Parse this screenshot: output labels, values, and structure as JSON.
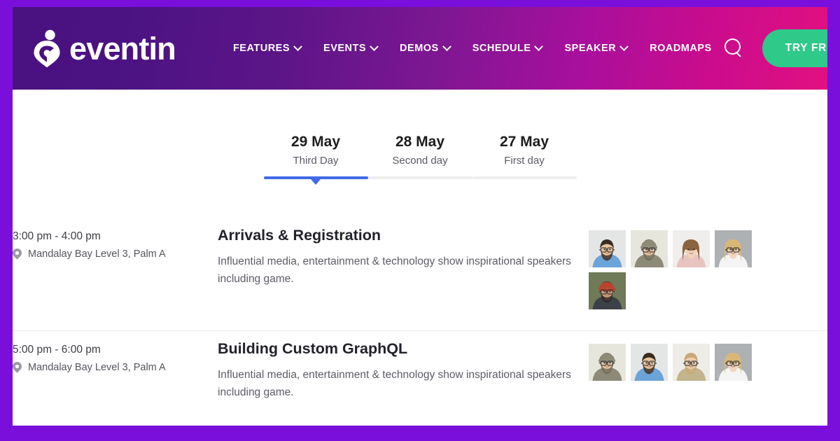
{
  "header": {
    "brand_name": "eventin",
    "brand_icon": "location-pin-check-logo",
    "nav": [
      {
        "label": "FEATURES",
        "has_dropdown": true
      },
      {
        "label": "EVENTS",
        "has_dropdown": true
      },
      {
        "label": "DEMOS",
        "has_dropdown": true
      },
      {
        "label": "SCHEDULE",
        "has_dropdown": true
      },
      {
        "label": "SPEAKER",
        "has_dropdown": true
      },
      {
        "label": "ROADMAPS",
        "has_dropdown": false
      }
    ],
    "search_icon": "search-icon",
    "cta_label": "TRY FREE",
    "cta_icon": "download-icon",
    "cta_color": "#2FC98A",
    "gradient_start": "#4A1280",
    "gradient_end": "#E21080"
  },
  "frame": {
    "border_color": "#7A0FDC",
    "background": "#ffffff"
  },
  "tabs": {
    "active_index": 0,
    "active_color": "#4169E8",
    "inactive_color": "#eeeeee",
    "items": [
      {
        "date": "29 May",
        "label": "Third Day"
      },
      {
        "date": "28 May",
        "label": "Second day"
      },
      {
        "date": "27 May",
        "label": "First day"
      }
    ]
  },
  "schedule": [
    {
      "time": "3:00 pm - 4:00 pm",
      "venue_icon": "map-pin-icon",
      "venue": "Mandalay Bay Level 3, Palm A",
      "title": "Arrivals & Registration",
      "description": "Influential media, entertainment & technology show inspirational speakers including game.",
      "speakers": [
        {
          "name": "speaker-avatar-1",
          "skin": "#e8c49c",
          "hair": "#3a2b21",
          "shirt": "#6ba4d8",
          "bg": "#e4e6e6",
          "glasses": true,
          "beard": true,
          "hat": "none",
          "hair_style": "short",
          "long": false
        },
        {
          "name": "speaker-avatar-2",
          "skin": "#e6c4a0",
          "hair": "#6e6a5c",
          "shirt": "#8d8a78",
          "bg": "#e6e6dc",
          "glasses": true,
          "beard": true,
          "hat": "beanie",
          "hat_color": "#8d8a78",
          "hair_style": "short",
          "long": false
        },
        {
          "name": "speaker-avatar-3",
          "skin": "#f0d2ba",
          "hair": "#8a6340",
          "shirt": "#e8c4c0",
          "bg": "#f0eeec",
          "glasses": false,
          "beard": false,
          "hat": "none",
          "hair_style": "long",
          "long": true
        },
        {
          "name": "speaker-avatar-4",
          "skin": "#f2d6bc",
          "hair": "#d8b878",
          "shirt": "#f4f4f4",
          "bg": "#aeb1b3",
          "glasses": true,
          "beard": false,
          "hat": "none",
          "hair_style": "long",
          "long": true
        },
        {
          "name": "speaker-avatar-5",
          "skin": "#c89a78",
          "hair": "#2e2520",
          "shirt": "#3c4048",
          "bg": "#6e7a58",
          "glasses": true,
          "beard": true,
          "hat": "beanie",
          "hat_color": "#b8442e",
          "hair_style": "short",
          "long": false
        }
      ]
    },
    {
      "time": "5:00 pm - 6:00 pm",
      "venue_icon": "map-pin-icon",
      "venue": "Mandalay Bay Level 3, Palm A",
      "title": "Building Custom GraphQL",
      "description": "Influential media, entertainment & technology show inspirational speakers including game.",
      "speakers": [
        {
          "name": "speaker-avatar-1",
          "skin": "#e6c4a0",
          "hair": "#6e6a5c",
          "shirt": "#8d8a78",
          "bg": "#e6e6dc",
          "glasses": true,
          "beard": true,
          "hat": "beanie",
          "hat_color": "#8d8a78",
          "hair_style": "short",
          "long": false
        },
        {
          "name": "speaker-avatar-2",
          "skin": "#e8c49c",
          "hair": "#3a2b21",
          "shirt": "#6ba4d8",
          "bg": "#e4e6e6",
          "glasses": true,
          "beard": true,
          "hat": "none",
          "hair_style": "short",
          "long": false
        },
        {
          "name": "speaker-avatar-3",
          "skin": "#eccfae",
          "hair": "#c8a878",
          "shirt": "#c2b48c",
          "bg": "#eeece6",
          "glasses": true,
          "beard": true,
          "hat": "none",
          "hair_style": "short",
          "long": false
        },
        {
          "name": "speaker-avatar-4",
          "skin": "#f2d6bc",
          "hair": "#d8b878",
          "shirt": "#f4f4f4",
          "bg": "#aeb1b3",
          "glasses": true,
          "beard": false,
          "hat": "none",
          "hair_style": "long",
          "long": true
        }
      ]
    }
  ]
}
